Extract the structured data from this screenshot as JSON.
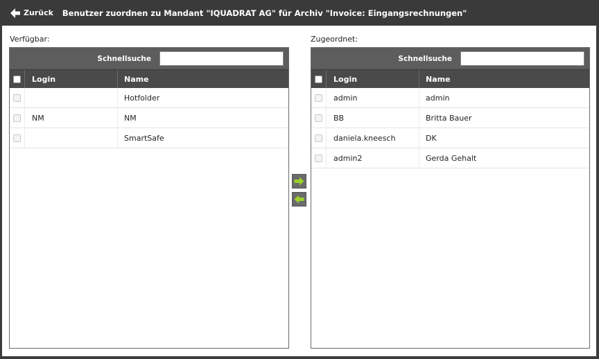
{
  "header": {
    "back_label": "Zurück",
    "title": "Benutzer zuordnen zu Mandant \"IQUADRAT AG\" für Archiv \"Invoice: Eingangsrechnungen\""
  },
  "available": {
    "label": "Verfügbar:",
    "search_label": "Schnellsuche",
    "search_value": "",
    "columns": {
      "login": "Login",
      "name": "Name"
    },
    "rows": [
      {
        "login": "",
        "name": "Hotfolder"
      },
      {
        "login": "NM",
        "name": "NM"
      },
      {
        "login": "",
        "name": "SmartSafe"
      }
    ]
  },
  "assigned": {
    "label": "Zugeordnet:",
    "search_label": "Schnellsuche",
    "search_value": "",
    "columns": {
      "login": "Login",
      "name": "Name"
    },
    "rows": [
      {
        "login": "admin",
        "name": "admin"
      },
      {
        "login": "BB",
        "name": "Britta Bauer"
      },
      {
        "login": "daniela.kneesch",
        "name": "DK"
      },
      {
        "login": "admin2",
        "name": "Gerda Gehalt"
      }
    ]
  },
  "icons": {
    "back": "arrow-left-icon",
    "move_right": "arrow-right-icon",
    "move_left": "arrow-left-icon"
  },
  "colors": {
    "header_bg": "#3a3a3a",
    "toolbar_bg": "#5d5d5d",
    "grid_head_bg": "#4a4a4a",
    "transfer_arrow": "#9bd12b"
  }
}
